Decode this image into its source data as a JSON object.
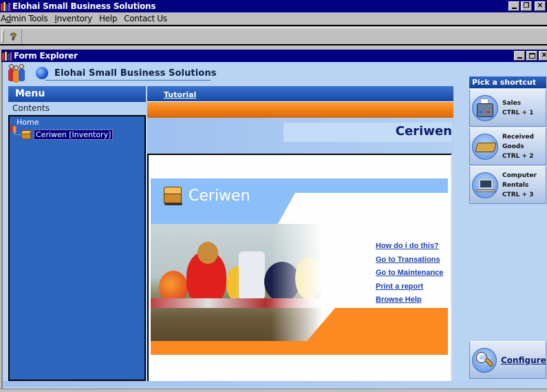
{
  "app": {
    "title": "Elohai Small Business Solutions",
    "window_controls": [
      "minimize",
      "restore",
      "close"
    ]
  },
  "menubar": {
    "items": [
      {
        "label": "Admin Tools",
        "accesskey": "d"
      },
      {
        "label": "Inventory",
        "accesskey": "I"
      },
      {
        "label": "Help"
      },
      {
        "label": "Contact Us"
      }
    ]
  },
  "toolbar": {
    "help_icon": "question-mark-icon",
    "help_glyph": "?"
  },
  "child_window": {
    "title": "Form Explorer",
    "window_controls": [
      "minimize",
      "maximize",
      "close"
    ]
  },
  "banner": {
    "title": "Elohai Small Business Solutions"
  },
  "menu": {
    "header": "Menu",
    "contents_label": "Contents",
    "tree": {
      "root": {
        "label": "Home",
        "icon": "people-icon"
      },
      "children": [
        {
          "label": "Ceriwen [Inventory]",
          "icon": "package-box-icon",
          "selected": true
        }
      ]
    }
  },
  "main": {
    "tutorial_label": "Tutorial",
    "page_title": "Ceriwen",
    "hero_title": "Ceriwen",
    "links": [
      "How do i do this?",
      "Go to Transations",
      "Go to Maintenance",
      "Print a report",
      "Browse Help"
    ]
  },
  "shortcuts": {
    "header": "Pick a shortcut",
    "items": [
      {
        "lines": [
          "Sales",
          "CTRL + 1"
        ],
        "icon": "cash-register-icon"
      },
      {
        "lines": [
          "Received",
          "Goods",
          "CTRL + 2"
        ],
        "icon": "package-icon"
      },
      {
        "lines": [
          "Computer",
          "Rentals",
          "CTRL + 3"
        ],
        "icon": "laptop-icon"
      }
    ],
    "configure_label": "Configure",
    "configure_icon": "wrench-icon"
  },
  "colors": {
    "titlebar": "#000080",
    "menu_blue": "#2e65be",
    "accent_orange": "#fb8a22",
    "link_blue": "#1a3fb0",
    "page_title": "#0d1b6e"
  }
}
